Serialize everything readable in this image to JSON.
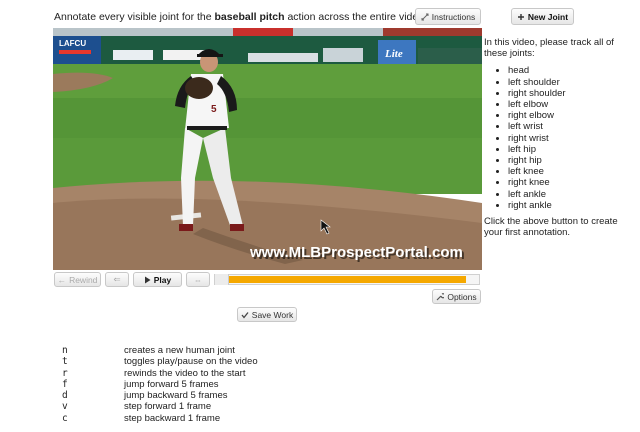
{
  "header": {
    "instruction_prefix": "Annotate every visible joint for the",
    "action_name": "baseball pitch",
    "instruction_suffix": "action across the entire video.",
    "instructions_label": "Instructions",
    "new_joint_label": "New Joint"
  },
  "video": {
    "watermark": "www.MLBProspectPortal.com",
    "sign_lafcu": "LAFCU",
    "sign_lite": "Lite"
  },
  "side_panel": {
    "intro": "In this video, please track all of these joints:",
    "joints": [
      "head",
      "left shoulder",
      "right shoulder",
      "left elbow",
      "right elbow",
      "left wrist",
      "right wrist",
      "left hip",
      "right hip",
      "left knee",
      "right knee",
      "left ankle",
      "right ankle"
    ],
    "footer": "Click the above button to create your first annotation."
  },
  "controls": {
    "rewind_label": "Rewind",
    "play_label": "Play",
    "options_label": "Options",
    "save_label": "Save Work",
    "progress_fraction": 0.95
  },
  "shortcuts": [
    {
      "key": "n",
      "description": "creates a new human joint"
    },
    {
      "key": "t",
      "description": "toggles play/pause on the video"
    },
    {
      "key": "r",
      "description": "rewinds the video to the start"
    },
    {
      "key": "f",
      "description": "jump forward 5 frames"
    },
    {
      "key": "d",
      "description": "jump backward 5 frames"
    },
    {
      "key": "v",
      "description": "step forward 1 frame"
    },
    {
      "key": "c",
      "description": "step backward 1 frame"
    }
  ],
  "colors": {
    "progress": "#f5a800"
  }
}
